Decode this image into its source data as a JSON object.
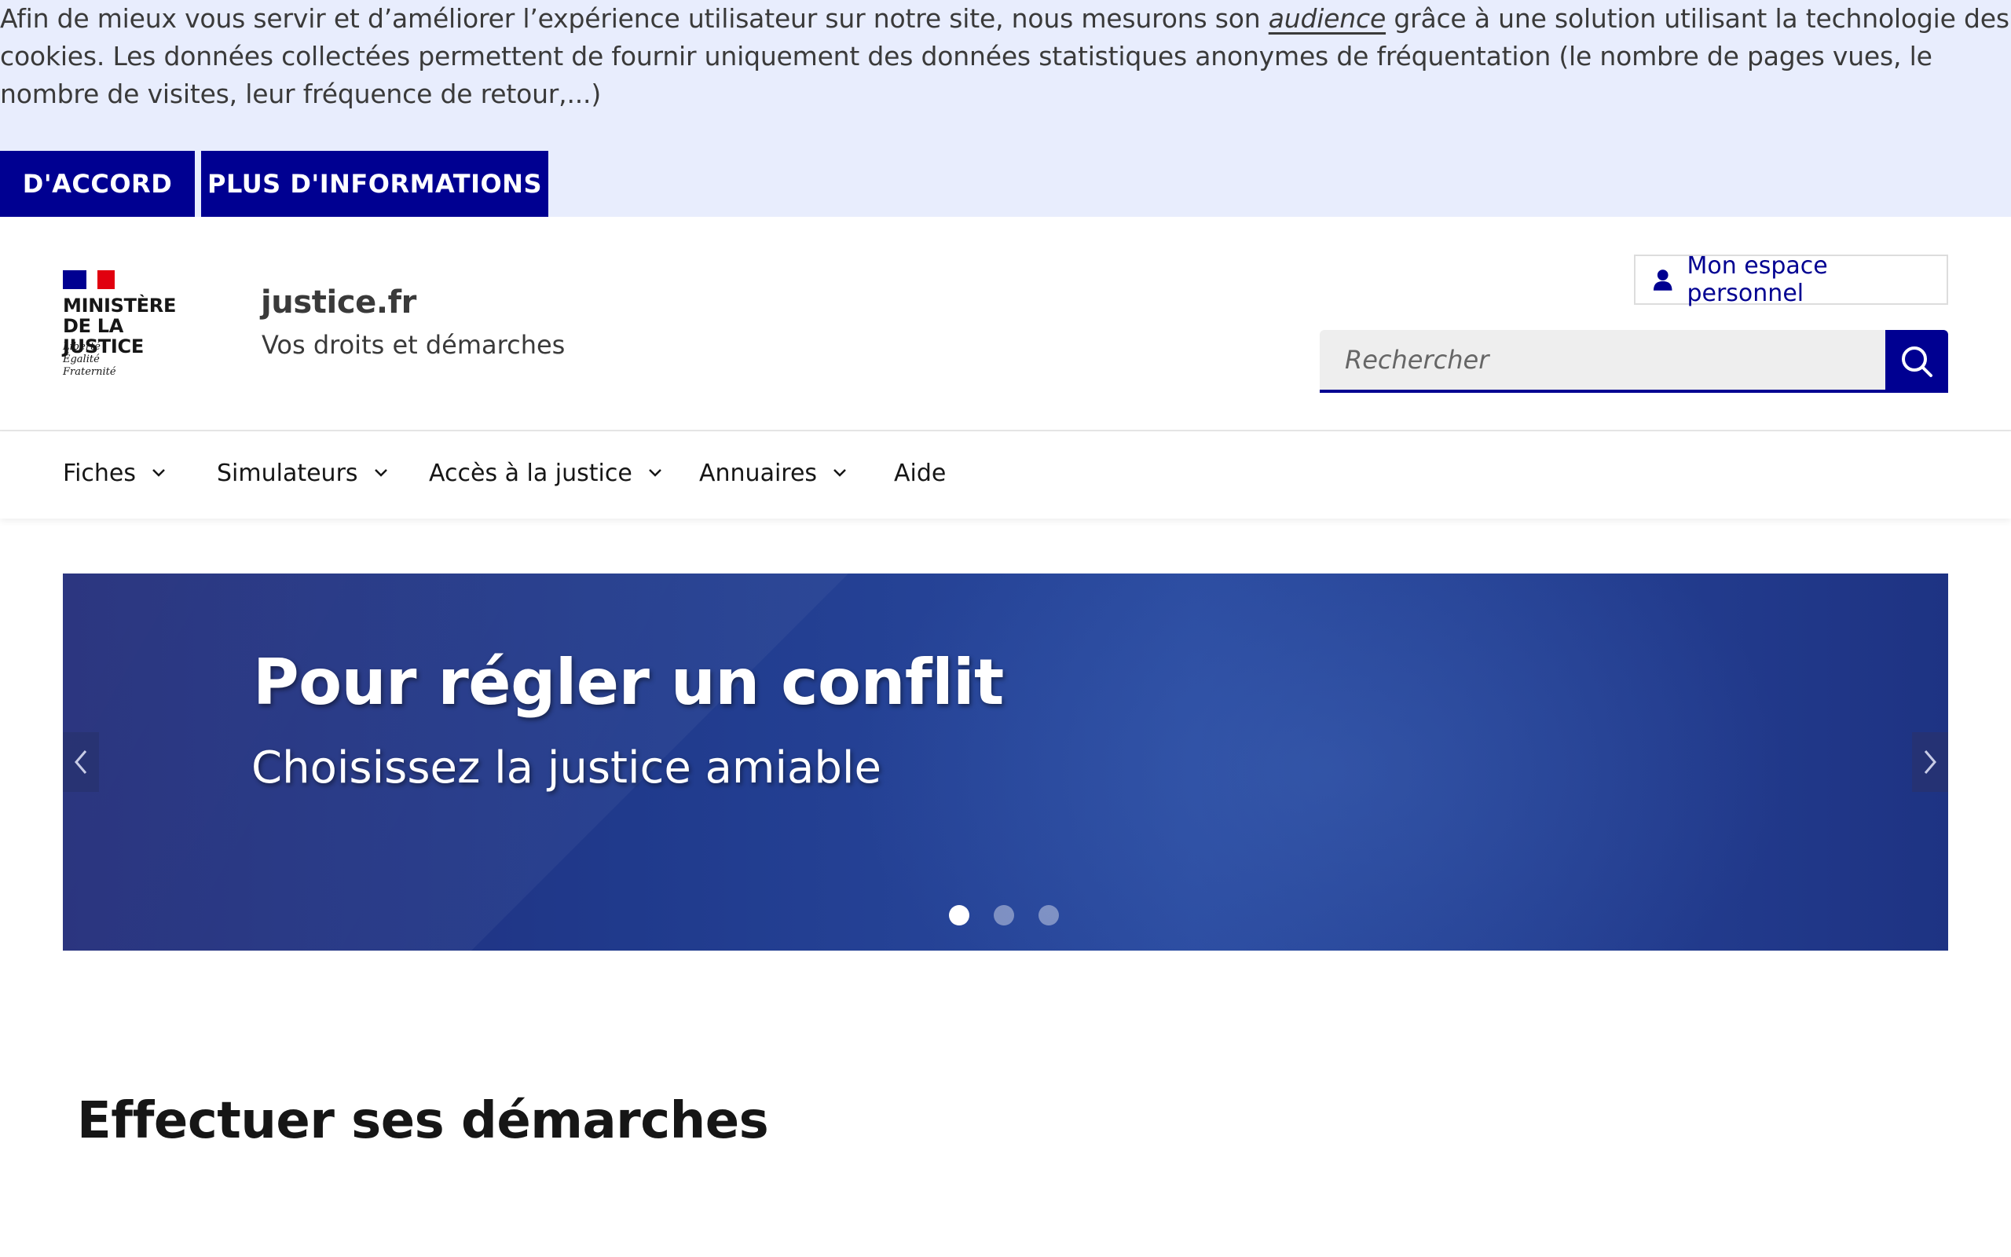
{
  "cookie_banner": {
    "text_before": "Afin de mieux vous servir et d’améliorer l’expérience utilisateur sur notre site, nous mesurons son ",
    "link_audience": "audience",
    "text_after": " grâce à une solution utilisant la technologie des cookies. Les données collectées permettent de fournir uniquement des données statistiques anonymes de fréquentation (le nombre de pages vues, le nombre de visites, leur fréquence de retour,...)",
    "accept_label": "D'ACCORD",
    "more_label": "PLUS D'INFORMATIONS"
  },
  "header": {
    "logo": {
      "title_line1": "MINISTÈRE",
      "title_line2": "DE LA JUSTICE",
      "motto_line1": "Liberté",
      "motto_line2": "Égalité",
      "motto_line3": "Fraternité"
    },
    "site_name": "justice.fr",
    "tagline": "Vos droits et démarches",
    "account_label": "Mon espace personnel",
    "search_placeholder": "Rechercher"
  },
  "nav": {
    "items": [
      {
        "label": "Fiches",
        "has_dropdown": true
      },
      {
        "label": "Simulateurs",
        "has_dropdown": true
      },
      {
        "label": "Accès à la justice",
        "has_dropdown": true
      },
      {
        "label": "Annuaires",
        "has_dropdown": true
      },
      {
        "label": "Aide",
        "has_dropdown": false
      }
    ]
  },
  "carousel": {
    "title": "Pour régler un conflit",
    "subtitle": "Choisissez la justice amiable",
    "slide_count": 3,
    "active_slide": 1
  },
  "main": {
    "section_title": "Effectuer ses démarches"
  },
  "colors": {
    "primary": "#000091",
    "banner_bg": "#e8edfd",
    "flag_red": "#e1000f"
  }
}
